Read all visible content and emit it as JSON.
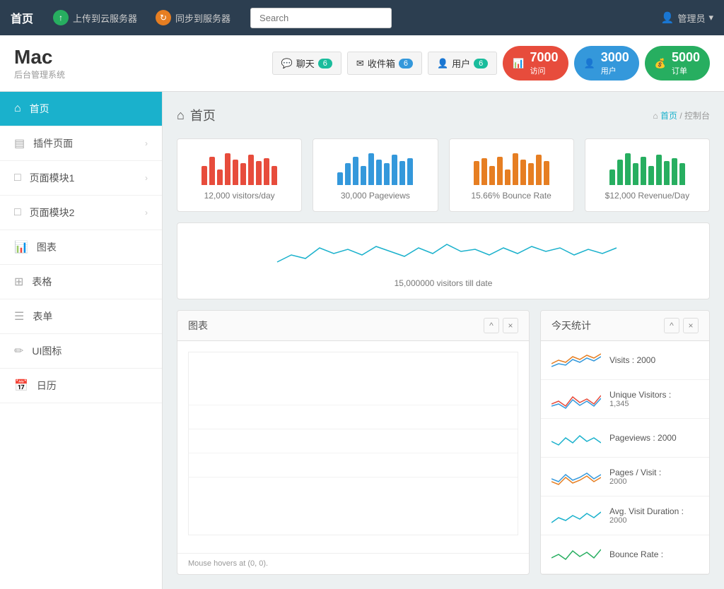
{
  "topnav": {
    "brand": "首页",
    "upload_btn": "上传到云服务器",
    "sync_btn": "同步到服务器",
    "search_placeholder": "Search",
    "admin_label": "管理员"
  },
  "header": {
    "title": "Mac",
    "subtitle": "后台管理系统",
    "chat_label": "聊天",
    "chat_count": "6",
    "inbox_label": "收件箱",
    "inbox_count": "6",
    "users_label": "用户",
    "users_count": "6",
    "visits_num": "7000",
    "visits_label": "访问",
    "members_num": "3000",
    "members_label": "用户",
    "orders_num": "5000",
    "orders_label": "订单"
  },
  "sidebar": {
    "home_label": "首页",
    "items": [
      {
        "id": "plugins",
        "label": "插件页面",
        "has_arrow": true
      },
      {
        "id": "modules1",
        "label": "页面模块1",
        "has_arrow": true
      },
      {
        "id": "modules2",
        "label": "页面模块2",
        "has_arrow": true
      },
      {
        "id": "charts",
        "label": "图表",
        "has_arrow": false
      },
      {
        "id": "tables",
        "label": "表格",
        "has_arrow": false
      },
      {
        "id": "forms",
        "label": "表单",
        "has_arrow": false
      },
      {
        "id": "icons",
        "label": "UI图标",
        "has_arrow": false
      },
      {
        "id": "calendar",
        "label": "日历",
        "has_arrow": false
      }
    ]
  },
  "breadcrumb": {
    "page_title": "首页",
    "home": "首页",
    "current": "控制台"
  },
  "stat_cards": [
    {
      "label": "12,000 visitors/day",
      "color": "red",
      "bars": [
        30,
        45,
        25,
        50,
        40,
        35,
        48,
        38,
        42,
        30
      ]
    },
    {
      "label": "30,000 Pageviews",
      "color": "blue",
      "bars": [
        20,
        35,
        45,
        30,
        50,
        40,
        35,
        48,
        38,
        42
      ]
    },
    {
      "label": "15.66% Bounce Rate",
      "color": "orange",
      "bars": [
        38,
        42,
        30,
        45,
        25,
        50,
        40,
        35,
        48,
        38
      ]
    },
    {
      "label": "$12,000 Revenue/Day",
      "color": "green",
      "bars": [
        25,
        40,
        50,
        35,
        45,
        30,
        48,
        38,
        42,
        35
      ]
    }
  ],
  "sparkline_card": {
    "label": "15,000000 visitors till date"
  },
  "charts_panel": {
    "title": "图表",
    "footer": "Mouse hovers at (0, 0)."
  },
  "stats_panel": {
    "title": "今天统计",
    "items": [
      {
        "label": "Visits : 2000"
      },
      {
        "label": "Unique Visitors :",
        "sub": "1,345"
      },
      {
        "label": "Pageviews : 2000"
      },
      {
        "label": "Pages / Visit :",
        "sub": "2000"
      },
      {
        "label": "Avg. Visit Duration :",
        "sub": "2000"
      },
      {
        "label": "Bounce Rate :"
      }
    ]
  }
}
